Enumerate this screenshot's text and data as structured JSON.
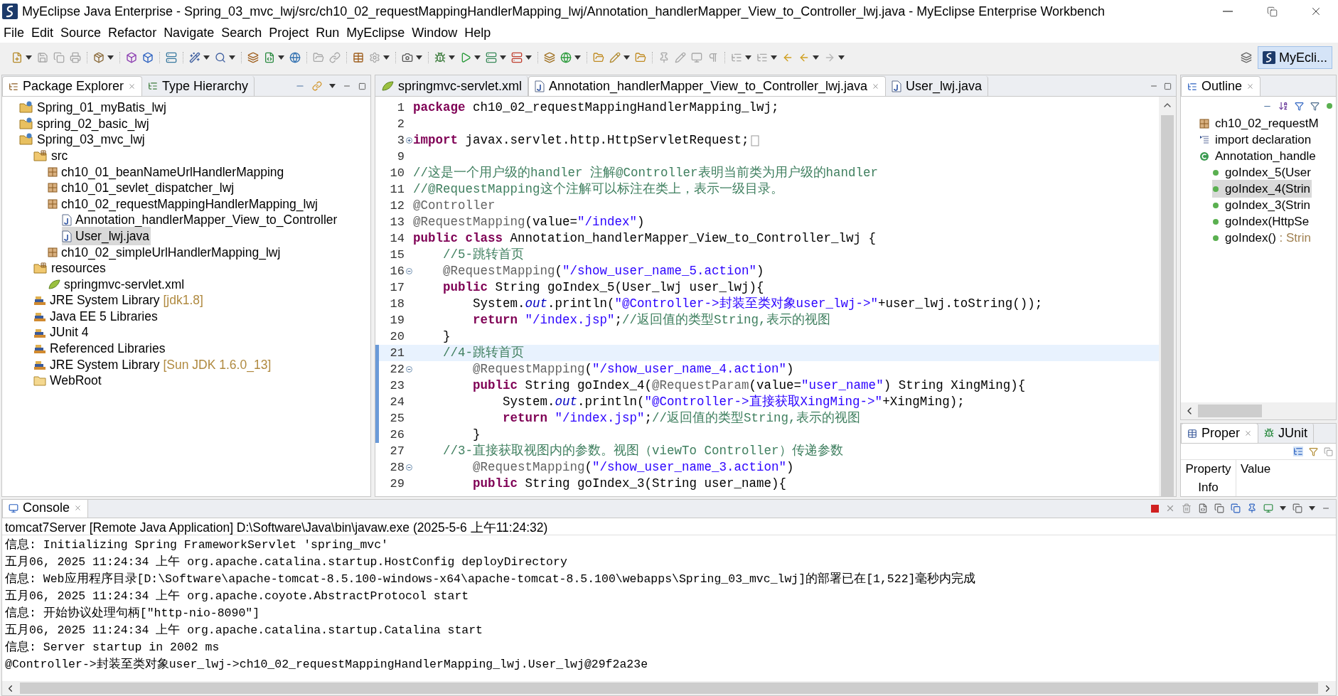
{
  "window": {
    "title": "MyEclipse Java Enterprise - Spring_03_mvc_lwj/src/ch10_02_requestMappingHandlerMapping_lwj/Annotation_handlerMapper_View_to_Controller_lwj.java - MyEclipse Enterprise Workbench"
  },
  "menu": [
    "File",
    "Edit",
    "Source",
    "Refactor",
    "Navigate",
    "Search",
    "Project",
    "Run",
    "MyEclipse",
    "Window",
    "Help"
  ],
  "perspective": {
    "label": "MyEcli...",
    "selected": true
  },
  "explorer": {
    "tabs": [
      {
        "label": "Package Explorer",
        "selected": true
      },
      {
        "label": "Type Hierarchy",
        "selected": false
      }
    ],
    "tree": [
      {
        "kind": "project",
        "label": "Spring_01_myBatis_lwj",
        "selected": false
      },
      {
        "kind": "project",
        "label": "spring_02_basic_lwj",
        "selected": false
      },
      {
        "kind": "project",
        "label": "Spring_03_mvc_lwj",
        "selected": false,
        "children": [
          {
            "kind": "source-folder",
            "label": "src",
            "selected": false,
            "children": [
              {
                "kind": "package",
                "label": "ch10_01_beanNameUrlHandlerMapping",
                "selected": false
              },
              {
                "kind": "package",
                "label": "ch10_01_sevlet_dispatcher_lwj",
                "selected": false
              },
              {
                "kind": "package",
                "label": "ch10_02_requestMappingHandlerMapping_lwj",
                "selected": false,
                "children": [
                  {
                    "kind": "java",
                    "label": "Annotation_handlerMapper_View_to_Controller",
                    "selected": false
                  },
                  {
                    "kind": "java",
                    "label": "User_lwj.java",
                    "selected": true
                  }
                ]
              },
              {
                "kind": "package",
                "label": "ch10_02_simpleUrlHandlerMapping_lwj",
                "selected": false
              }
            ]
          },
          {
            "kind": "source-folder",
            "label": "resources",
            "selected": false,
            "children": [
              {
                "kind": "xml",
                "label": "springmvc-servlet.xml",
                "selected": false
              }
            ]
          },
          {
            "kind": "library",
            "label": "JRE System Library",
            "detail": "[jdk1.8]",
            "selected": false
          },
          {
            "kind": "library",
            "label": "Java EE 5 Libraries",
            "selected": false
          },
          {
            "kind": "library",
            "label": "JUnit 4",
            "selected": false
          },
          {
            "kind": "library",
            "label": "Referenced Libraries",
            "selected": false
          },
          {
            "kind": "library",
            "label": "JRE System Library",
            "detail": "[Sun JDK 1.6.0_13]",
            "selected": false
          },
          {
            "kind": "folder",
            "label": "WebRoot",
            "selected": false
          }
        ]
      }
    ]
  },
  "editor": {
    "tabs": [
      {
        "kind": "xml",
        "label": "springmvc-servlet.xml",
        "selected": false
      },
      {
        "kind": "java",
        "label": "Annotation_handlerMapper_View_to_Controller_lwj.java",
        "selected": true
      },
      {
        "kind": "java",
        "label": "User_lwj.java",
        "selected": false
      }
    ],
    "lines": [
      {
        "no": "1",
        "current": false,
        "changed": false,
        "tokens": [
          {
            "kind": "keyword",
            "text": "package"
          },
          {
            "kind": "plain",
            "text": " ch10_02_requestMappingHandlerMapping_lwj;"
          }
        ]
      },
      {
        "no": "2",
        "current": false,
        "changed": false
      },
      {
        "no": "3",
        "collapsed": true,
        "current": false,
        "changed": false,
        "tokens": [
          {
            "kind": "keyword",
            "text": "import"
          },
          {
            "kind": "plain",
            "text": " javax.servlet.http.HttpServletRequest;"
          }
        ]
      },
      {
        "no": "9",
        "current": false,
        "changed": false
      },
      {
        "no": "10",
        "current": false,
        "changed": false,
        "tokens": [
          {
            "kind": "comment",
            "text": "//这是一个用户级的handler 注解@Controller表明当前类为用户级的handler"
          }
        ]
      },
      {
        "no": "11",
        "current": false,
        "changed": false,
        "tokens": [
          {
            "kind": "comment",
            "text": "//@RequestMapping这个注解可以标注在类上，表示一级目录。"
          }
        ]
      },
      {
        "no": "12",
        "current": false,
        "changed": false,
        "tokens": [
          {
            "kind": "annotation",
            "text": "@Controller"
          }
        ]
      },
      {
        "no": "13",
        "current": false,
        "changed": false,
        "tokens": [
          {
            "kind": "annotation",
            "text": "@RequestMapping"
          },
          {
            "kind": "plain",
            "text": "(value="
          },
          {
            "kind": "string",
            "text": "\"/index\""
          },
          {
            "kind": "plain",
            "text": ")"
          }
        ]
      },
      {
        "no": "14",
        "current": false,
        "changed": false,
        "tokens": [
          {
            "kind": "keyword",
            "text": "public class"
          },
          {
            "kind": "plain",
            "text": " Annotation_handlerMapper_View_to_Controller_lwj {"
          }
        ]
      },
      {
        "no": "15",
        "current": false,
        "changed": false,
        "tokens": [
          {
            "kind": "comment",
            "text": "    //5-跳转首页"
          }
        ]
      },
      {
        "no": "16",
        "collapsed": false,
        "current": false,
        "changed": false,
        "tokens": [
          {
            "kind": "annotation",
            "text": "    @RequestMapping"
          },
          {
            "kind": "plain",
            "text": "("
          },
          {
            "kind": "string",
            "text": "\"/show_user_name_5.action\""
          },
          {
            "kind": "plain",
            "text": ")"
          }
        ]
      },
      {
        "no": "17",
        "current": false,
        "changed": false,
        "tokens": [
          {
            "kind": "keyword",
            "text": "    public"
          },
          {
            "kind": "plain",
            "text": " String goIndex_5(User_lwj user_lwj){"
          }
        ]
      },
      {
        "no": "18",
        "current": false,
        "changed": false,
        "tokens": [
          {
            "kind": "plain",
            "text": "        System."
          },
          {
            "kind": "field",
            "text": "out"
          },
          {
            "kind": "plain",
            "text": ".println("
          },
          {
            "kind": "string",
            "text": "\"@Controller->封装至类对象user_lwj->\""
          },
          {
            "kind": "plain",
            "text": "+user_lwj.toString());"
          }
        ]
      },
      {
        "no": "19",
        "current": false,
        "changed": false,
        "tokens": [
          {
            "kind": "keyword",
            "text": "        return"
          },
          {
            "kind": "string",
            "text": " \"/index.jsp\""
          },
          {
            "kind": "plain",
            "text": ";"
          },
          {
            "kind": "comment",
            "text": "//返回值的类型String,表示的视图"
          }
        ]
      },
      {
        "no": "20",
        "current": false,
        "changed": false,
        "tokens": [
          {
            "kind": "plain",
            "text": "    }"
          }
        ]
      },
      {
        "no": "21",
        "current": true,
        "changed": true,
        "tokens": [
          {
            "kind": "comment",
            "text": "    //4-跳转首页"
          }
        ]
      },
      {
        "no": "22",
        "collapsed": false,
        "current": false,
        "changed": true,
        "tokens": [
          {
            "kind": "annotation",
            "text": "        @RequestMapping"
          },
          {
            "kind": "plain",
            "text": "("
          },
          {
            "kind": "string",
            "text": "\"/show_user_name_4.action\""
          },
          {
            "kind": "plain",
            "text": ")"
          }
        ]
      },
      {
        "no": "23",
        "current": false,
        "changed": true,
        "tokens": [
          {
            "kind": "keyword",
            "text": "        public"
          },
          {
            "kind": "plain",
            "text": " String goIndex_4("
          },
          {
            "kind": "annotation",
            "text": "@RequestParam"
          },
          {
            "kind": "plain",
            "text": "(value="
          },
          {
            "kind": "string",
            "text": "\"user_name\""
          },
          {
            "kind": "plain",
            "text": ") String XingMing){"
          }
        ]
      },
      {
        "no": "24",
        "current": false,
        "changed": true,
        "tokens": [
          {
            "kind": "plain",
            "text": "            System."
          },
          {
            "kind": "field",
            "text": "out"
          },
          {
            "kind": "plain",
            "text": ".println("
          },
          {
            "kind": "string",
            "text": "\"@Controller->直接获取XingMing->\""
          },
          {
            "kind": "plain",
            "text": "+XingMing);"
          }
        ]
      },
      {
        "no": "25",
        "current": false,
        "changed": true,
        "tokens": [
          {
            "kind": "keyword",
            "text": "            return"
          },
          {
            "kind": "string",
            "text": " \"/index.jsp\""
          },
          {
            "kind": "plain",
            "text": ";"
          },
          {
            "kind": "comment",
            "text": "//返回值的类型String,表示的视图"
          }
        ]
      },
      {
        "no": "26",
        "current": false,
        "changed": true,
        "tokens": [
          {
            "kind": "plain",
            "text": "        }"
          }
        ]
      },
      {
        "no": "27",
        "current": false,
        "changed": false,
        "tokens": [
          {
            "kind": "comment",
            "text": "    //3-直接获取视图内的参数。视图（viewTo Controller）传递参数"
          }
        ]
      },
      {
        "no": "28",
        "collapsed": false,
        "current": false,
        "changed": false,
        "tokens": [
          {
            "kind": "annotation",
            "text": "        @RequestMapping"
          },
          {
            "kind": "plain",
            "text": "("
          },
          {
            "kind": "string",
            "text": "\"/show_user_name_3.action\""
          },
          {
            "kind": "plain",
            "text": ")"
          }
        ]
      },
      {
        "no": "29",
        "current": false,
        "changed": false,
        "tokens": [
          {
            "kind": "keyword",
            "text": "        public"
          },
          {
            "kind": "plain",
            "text": " String goIndex_3(String user_name){"
          }
        ]
      }
    ]
  },
  "outline": {
    "tabs": [
      {
        "label": "Outline",
        "selected": true
      }
    ],
    "items": [
      {
        "kind": "package",
        "label": "ch10_02_requestM",
        "selected": false
      },
      {
        "kind": "imports",
        "label": "import declaration",
        "selected": false
      },
      {
        "kind": "class",
        "label": "Annotation_handle",
        "selected": false,
        "children": [
          {
            "kind": "method",
            "label": "goIndex_5(User",
            "selected": false
          },
          {
            "kind": "method",
            "label": "goIndex_4(Strin",
            "selected": true
          },
          {
            "kind": "method",
            "label": "goIndex_3(Strin",
            "selected": false
          },
          {
            "kind": "method",
            "label": "goIndex(HttpSe",
            "selected": false
          },
          {
            "kind": "method",
            "label": "goIndex()",
            "detail": ": Strin",
            "selected": false
          }
        ]
      }
    ]
  },
  "properties": {
    "tabs": [
      {
        "label": "Proper",
        "selected": true
      },
      {
        "label": "JUnit",
        "selected": false
      }
    ],
    "columns": [
      "Property",
      "Value"
    ],
    "rows": [
      "Info"
    ]
  },
  "console": {
    "tabs": [
      {
        "label": "Console",
        "selected": true
      }
    ],
    "description": "tomcat7Server [Remote Java Application] D:\\Software\\Java\\bin\\javaw.exe (2025-5-6 上午11:24:32)",
    "lines": [
      "信息: Initializing Spring FrameworkServlet 'spring_mvc'",
      "五月06, 2025 11:24:34 上午 org.apache.catalina.startup.HostConfig deployDirectory",
      "信息: Web应用程序目录[D:\\Software\\apache-tomcat-8.5.100-windows-x64\\apache-tomcat-8.5.100\\webapps\\Spring_03_mvc_lwj]的部署已在[1,522]毫秒内完成",
      "五月06, 2025 11:24:34 上午 org.apache.coyote.AbstractProtocol start",
      "信息: 开始协议处理句柄[\"http-nio-8090\"]",
      "五月06, 2025 11:24:34 上午 org.apache.catalina.startup.Catalina start",
      "信息: Server startup in 2002 ms",
      "@Controller->封装至类对象user_lwj->ch10_02_requestMappingHandlerMapping_lwj.User_lwj@29f2a23e"
    ]
  }
}
